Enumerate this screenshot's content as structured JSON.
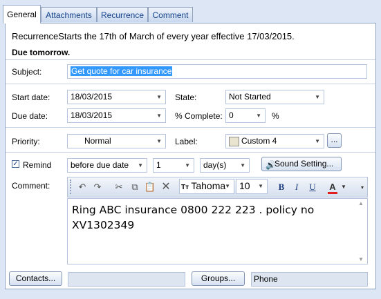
{
  "tabs": [
    "General",
    "Attachments",
    "Recurrence",
    "Comment"
  ],
  "info": {
    "recurrence_text": "RecurrenceStarts the 17th of March of every year effective 17/03/2015.",
    "due_text": "Due tomorrow."
  },
  "subject": {
    "label": "Subject:",
    "value": "Get quote for car insurance"
  },
  "start_date": {
    "label": "Start date:",
    "value": "18/03/2015"
  },
  "due_date": {
    "label": "Due date:",
    "value": "18/03/2015"
  },
  "state": {
    "label": "State:",
    "value": "Not Started"
  },
  "complete": {
    "label": "% Complete:",
    "value": "0",
    "unit": "%"
  },
  "priority": {
    "label": "Priority:",
    "value": "Normal"
  },
  "label_field": {
    "label": "Label:",
    "value": "Custom 4",
    "more": "..."
  },
  "remind": {
    "label": "Remind",
    "checked": true,
    "when": "before due date",
    "amount": "1",
    "unit": "day(s)",
    "sound_button": "Sound Setting..."
  },
  "comment": {
    "label": "Comment:",
    "font": "Tahoma",
    "size": "10",
    "text": "Ring ABC insurance 0800 222 223 . policy no XV1302349"
  },
  "toolbar_icons": [
    "undo-icon",
    "redo-icon",
    "cut-icon",
    "copy-icon",
    "paste-icon",
    "delete-icon",
    "font-icon",
    "bold-icon",
    "italic-icon",
    "underline-icon",
    "font-color-icon"
  ],
  "format_letters": {
    "bold": "B",
    "italic": "I",
    "underline": "U",
    "color": "A",
    "font_glyph": "Tт"
  },
  "bottom": {
    "contacts_button": "Contacts...",
    "groups_button": "Groups...",
    "phone": "Phone"
  },
  "colors": {
    "label_swatch": "#e8e4cf",
    "accent": "#15428b",
    "selection": "#3399ff"
  }
}
